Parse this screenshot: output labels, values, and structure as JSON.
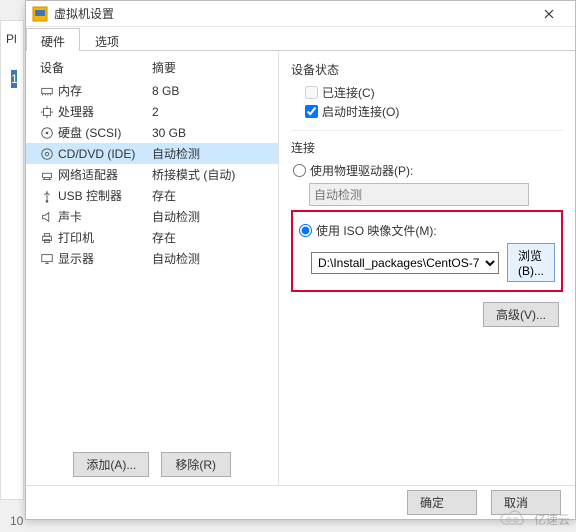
{
  "bg": {
    "pl": "Pl",
    "num": "1",
    "bottom": "10"
  },
  "titlebar": {
    "title": "虚拟机设置",
    "close": "×"
  },
  "tabs": {
    "hardware": "硬件",
    "options": "选项"
  },
  "hw_headers": {
    "device": "设备",
    "summary": "摘要"
  },
  "hw": [
    {
      "name": "内存",
      "summary": "8 GB",
      "icon": "memory-icon"
    },
    {
      "name": "处理器",
      "summary": "2",
      "icon": "cpu-icon"
    },
    {
      "name": "硬盘 (SCSI)",
      "summary": "30 GB",
      "icon": "disk-icon"
    },
    {
      "name": "CD/DVD (IDE)",
      "summary": "自动检测",
      "icon": "cd-icon"
    },
    {
      "name": "网络适配器",
      "summary": "桥接模式 (自动)",
      "icon": "network-icon"
    },
    {
      "name": "USB 控制器",
      "summary": "存在",
      "icon": "usb-icon"
    },
    {
      "name": "声卡",
      "summary": "自动检测",
      "icon": "sound-icon"
    },
    {
      "name": "打印机",
      "summary": "存在",
      "icon": "printer-icon"
    },
    {
      "name": "显示器",
      "summary": "自动检测",
      "icon": "display-icon"
    }
  ],
  "left_buttons": {
    "add": "添加(A)...",
    "remove": "移除(R)"
  },
  "status": {
    "title": "设备状态",
    "connected": "已连接(C)",
    "connect_on_start": "启动时连接(O)"
  },
  "connection": {
    "title": "连接",
    "use_physical": "使用物理驱动器(P):",
    "physical_value": "自动检测",
    "use_iso": "使用 ISO 映像文件(M):",
    "iso_value": "D:\\Install_packages\\CentOS-7",
    "browse": "浏览(B)..."
  },
  "advanced": {
    "label": "高级(V)..."
  },
  "footer": {
    "ok": "确定",
    "cancel": "取消"
  },
  "watermark": "亿速云"
}
